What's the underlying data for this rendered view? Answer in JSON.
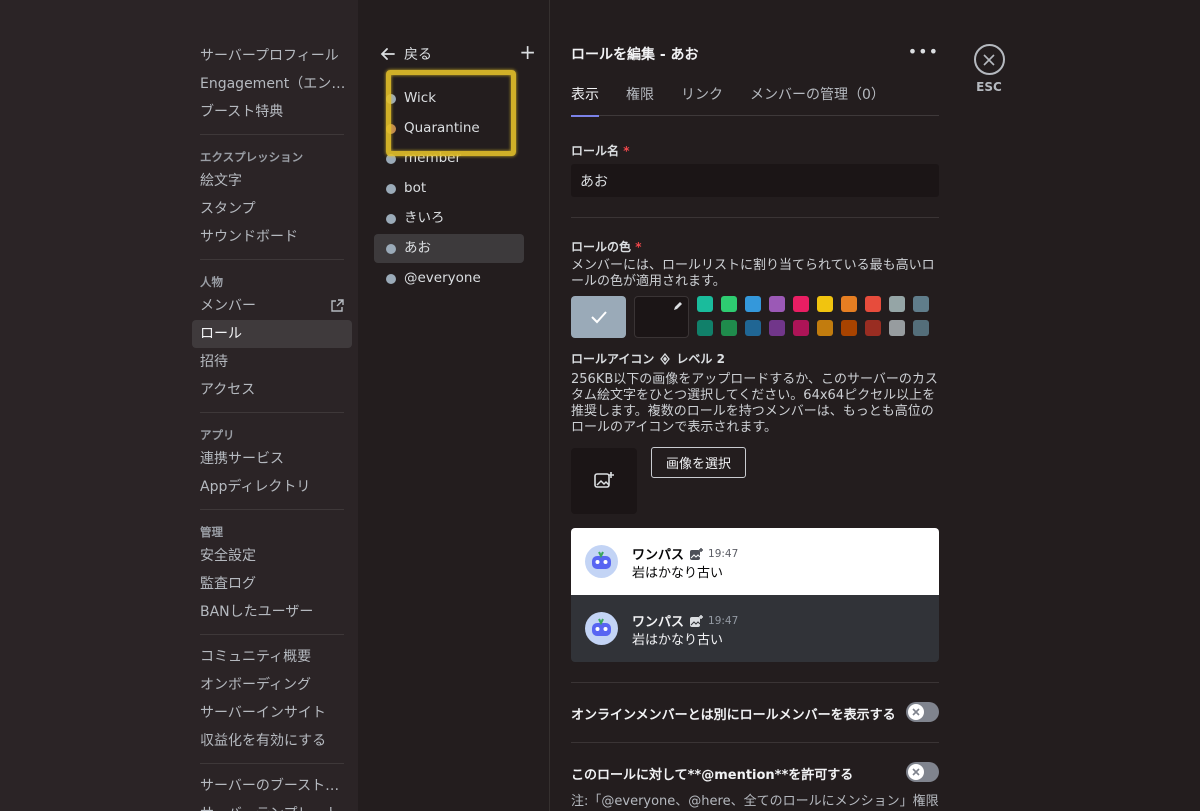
{
  "sidebar": {
    "top_items": [
      "サーバープロフィール",
      "Engagement（エンゲ...",
      "ブースト特典"
    ],
    "expression_header": "エクスプレッション",
    "expression_items": [
      "絵文字",
      "スタンプ",
      "サウンドボード"
    ],
    "people_header": "人物",
    "people_items": [
      "メンバー",
      "ロール",
      "招待",
      "アクセス"
    ],
    "apps_header": "アプリ",
    "apps_items": [
      "連携サービス",
      "Appディレクトリ"
    ],
    "mod_header": "管理",
    "mod_items": [
      "安全設定",
      "監査ログ",
      "BANしたユーザー"
    ],
    "community_items": [
      "コミュニティ概要",
      "オンボーディング",
      "サーバーインサイト",
      "収益化を有効にする"
    ],
    "bottom_items": [
      "サーバーのブースト状態",
      "サーバーテンプレート"
    ]
  },
  "roles": {
    "back_label": "戻る",
    "add_label": "+",
    "items": [
      {
        "name": "Wick",
        "color": "#9aaab8"
      },
      {
        "name": "Quarantine",
        "color": "#c08a4f"
      },
      {
        "name": "member",
        "color": "#9aaab8"
      },
      {
        "name": "bot",
        "color": "#9aaab8"
      },
      {
        "name": "きいろ",
        "color": "#9aaab8"
      },
      {
        "name": "あお",
        "color": "#9aaab8"
      },
      {
        "name": "@everyone",
        "color": "#9aaab8"
      }
    ],
    "active": "あお"
  },
  "main": {
    "title": "ロールを編集 - あお",
    "more_label": "•••",
    "tabs": [
      "表示",
      "権限",
      "リンク",
      "メンバーの管理（0）"
    ],
    "role_name_label": "ロール名",
    "required_mark": "*",
    "role_name_value": "あお",
    "color_label": "ロールの色",
    "color_desc": "メンバーには、ロールリストに割り当てられている最も高いロールの色が適用されます。",
    "palette_row1": [
      "#1abc9c",
      "#2ecc71",
      "#3498db",
      "#9b59b6",
      "#e91e63",
      "#f1c40f",
      "#e67e22",
      "#e74c3c",
      "#95a5a6",
      "#607d8b"
    ],
    "palette_row2": [
      "#11806a",
      "#1f8b4c",
      "#206694",
      "#71368a",
      "#ad1457",
      "#c27c0e",
      "#a84300",
      "#992d22",
      "#979c9f",
      "#546e7a"
    ],
    "default_color": "#9aaab8",
    "icon_label": "ロールアイコン",
    "level_label": "レベル 2",
    "icon_desc": "256KB以下の画像をアップロードするか、このサーバーのカスタム絵文字をひとつ選択してください。64x64ピクセル以上を推奨します。複数のロールを持つメンバーは、もっとも高位のロールのアイコンで表示されます。",
    "choose_image": "画像を選択",
    "preview": {
      "username": "ワンパス",
      "time": "19:47",
      "message": "岩はかなり古い"
    },
    "toggle1_label": "オンラインメンバーとは別にロールメンバーを表示する",
    "toggle2_label": "このロールに対して**@mention**を許可する",
    "note": "注:「@everyone、@here、全てのロールにメンション」権限"
  },
  "close": {
    "esc_label": "ESC"
  }
}
